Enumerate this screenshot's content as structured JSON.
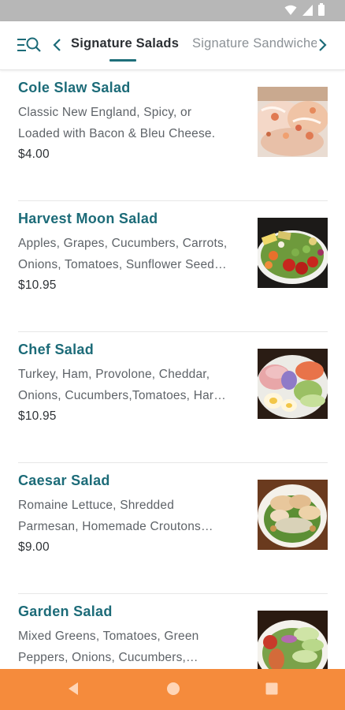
{
  "tabs": {
    "active_label": "Signature Salads",
    "next_label": "Signature Sandwiches"
  },
  "colors": {
    "accent": "#1c6b78",
    "nav_bar": "#f58b3c",
    "status_bar": "#b7b7b7"
  },
  "icons": {
    "menu_search": "menu-search-icon",
    "prev": "chevron-left-icon",
    "next": "chevron-right-icon",
    "back": "back-triangle-icon",
    "home": "home-circle-icon",
    "recents": "recents-square-icon"
  },
  "items": [
    {
      "name": "Cole Slaw Salad",
      "desc_line1": "Classic New England, Spicy, or",
      "desc_line2": "Loaded with Bacon & Bleu Cheese.",
      "price": "$4.00"
    },
    {
      "name": "Harvest Moon Salad",
      "desc_line1": "Apples, Grapes, Cucumbers, Carrots,",
      "desc_line2": "Onions, Tomatoes, Sunflower Seed…",
      "price": "$10.95"
    },
    {
      "name": "Chef Salad",
      "desc_line1": "Turkey, Ham, Provolone, Cheddar,",
      "desc_line2": "Onions, Cucumbers,Tomatoes, Har…",
      "price": "$10.95"
    },
    {
      "name": "Caesar Salad",
      "desc_line1": "Romaine Lettuce, Shredded",
      "desc_line2": "Parmesan, Homemade Croutons…",
      "price": "$9.00"
    },
    {
      "name": "Garden Salad",
      "desc_line1": "Mixed Greens, Tomatoes, Green",
      "desc_line2": "Peppers, Onions, Cucumbers,…",
      "price": ""
    }
  ]
}
